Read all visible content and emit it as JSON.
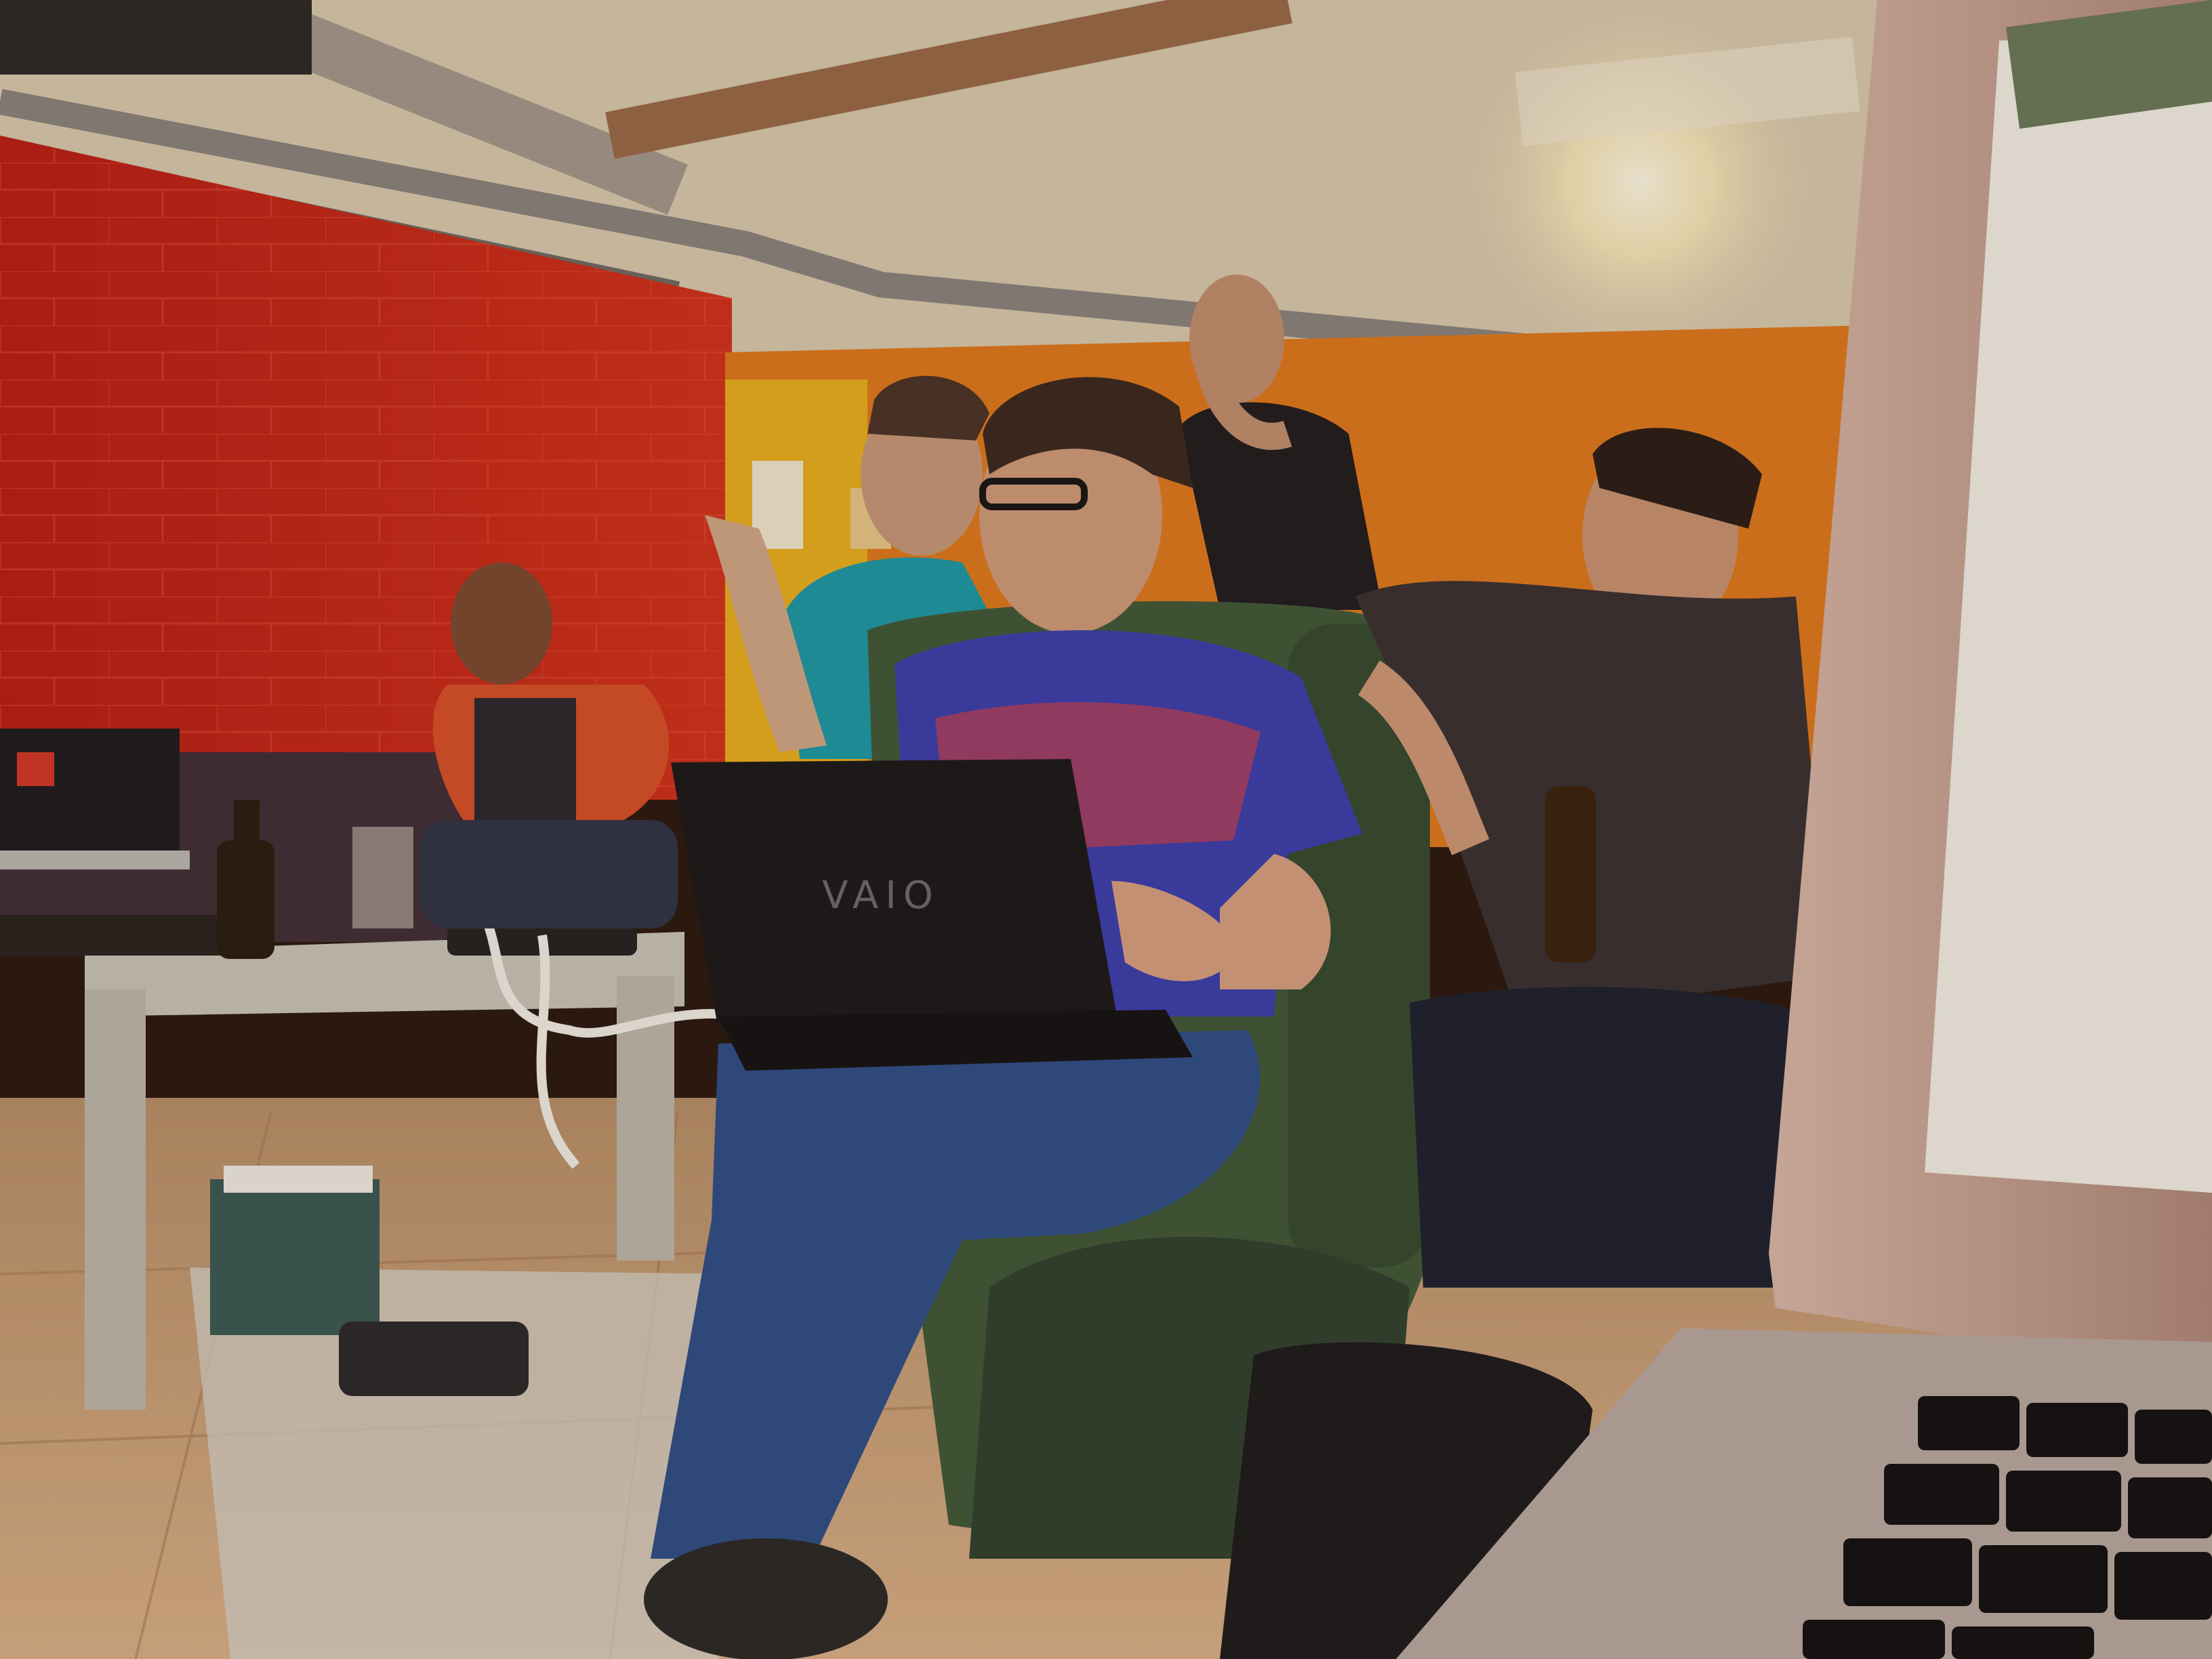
{
  "scene": {
    "laptop_brand": "VAIO"
  },
  "colors": {
    "red_wall": "#c8241a",
    "orange_wall": "#e07a1e",
    "ceiling": "#d8cbb0",
    "floor": "#c9a27a",
    "armchair": "#3f5a3a",
    "blue_tshirt": "#3b3fb0",
    "jeans": "#2e4f8a",
    "laptop_black": "#1b1a1c",
    "laptop_silver": "#c9b0a4",
    "teal_jacket": "#1a9aa8",
    "orange_jacket": "#d8502a",
    "screen_white": "#f3f1e8"
  }
}
